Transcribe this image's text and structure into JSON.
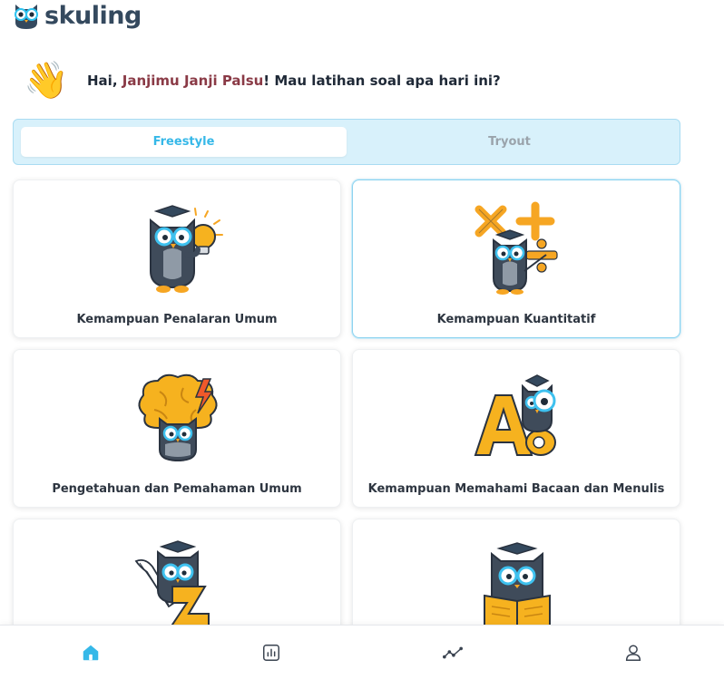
{
  "app": {
    "logo_text": "skuling"
  },
  "greeting": {
    "prefix": "Hai, ",
    "name": "Janjimu Janji Palsu",
    "suffix": "! Mau latihan soal apa hari ini?",
    "emoji": "👋"
  },
  "tabs": [
    {
      "label": "Freestyle",
      "active": true
    },
    {
      "label": "Tryout",
      "active": false
    }
  ],
  "cards": [
    {
      "label": "Kemampuan Penalaran Umum",
      "icon": "owl-lightbulb-icon"
    },
    {
      "label": "Kemampuan Kuantitatif",
      "icon": "owl-math-symbols-icon"
    },
    {
      "label": "Pengetahuan dan Pemahaman Umum",
      "icon": "owl-brain-icon"
    },
    {
      "label": "Kemampuan Memahami Bacaan dan Menulis",
      "icon": "owl-magnifier-letters-icon"
    },
    {
      "label": "",
      "icon": "owl-quill-scroll-icon"
    },
    {
      "label": "",
      "icon": "owl-reading-book-icon"
    }
  ],
  "nav": [
    {
      "name": "home",
      "icon": "home-icon",
      "active": true
    },
    {
      "name": "stats",
      "icon": "bar-chart-icon",
      "active": false
    },
    {
      "name": "progress",
      "icon": "trend-line-icon",
      "active": false
    },
    {
      "name": "profile",
      "icon": "user-icon",
      "active": false
    }
  ],
  "colors": {
    "accent": "#36b8e8",
    "name": "#8a3a46",
    "owl_body": "#3f4b5a",
    "owl_accent": "#f6a623",
    "text_dark": "#1f2937"
  }
}
